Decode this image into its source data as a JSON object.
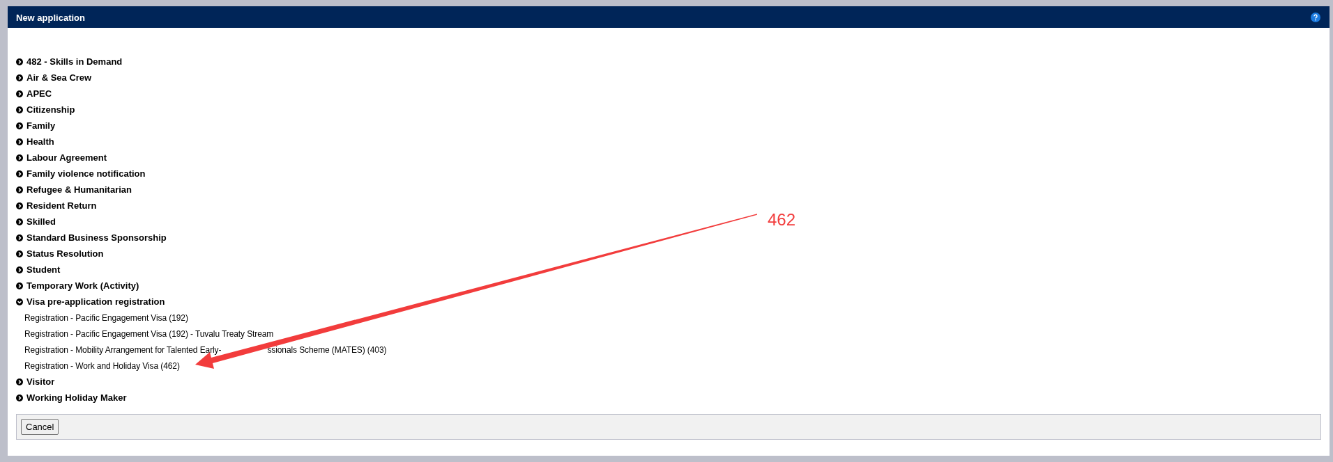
{
  "window": {
    "title": "New application"
  },
  "categories": [
    {
      "label": "482 - Skills in Demand",
      "expanded": false
    },
    {
      "label": "Air & Sea Crew",
      "expanded": false
    },
    {
      "label": "APEC",
      "expanded": false
    },
    {
      "label": "Citizenship",
      "expanded": false
    },
    {
      "label": "Family",
      "expanded": false
    },
    {
      "label": "Health",
      "expanded": false
    },
    {
      "label": "Labour Agreement",
      "expanded": false
    },
    {
      "label": "Family violence notification",
      "expanded": false
    },
    {
      "label": "Refugee & Humanitarian",
      "expanded": false
    },
    {
      "label": "Resident Return",
      "expanded": false
    },
    {
      "label": "Skilled",
      "expanded": false
    },
    {
      "label": "Standard Business Sponsorship",
      "expanded": false
    },
    {
      "label": "Status Resolution",
      "expanded": false
    },
    {
      "label": "Student",
      "expanded": false
    },
    {
      "label": "Temporary Work (Activity)",
      "expanded": false
    },
    {
      "label": "Visa pre-application registration",
      "expanded": true,
      "children": [
        {
          "parts": [
            "Registration - Pacific Engagement Visa (192)"
          ]
        },
        {
          "parts": [
            "Registration - Pacific Engagement Visa (192) - Tuvalu Treaty Stream"
          ]
        },
        {
          "parts": [
            "Registration - Mobility Arrangement for Talented Early-",
            "ssionals Scheme (MATES) (403)"
          ]
        },
        {
          "parts": [
            "Registration - Work and Holiday Visa (462)"
          ]
        }
      ]
    },
    {
      "label": "Visitor",
      "expanded": false
    },
    {
      "label": "Working Holiday Maker",
      "expanded": false
    }
  ],
  "footer": {
    "buttons": [
      "Cancel"
    ]
  },
  "annotation": {
    "label": "462"
  }
}
